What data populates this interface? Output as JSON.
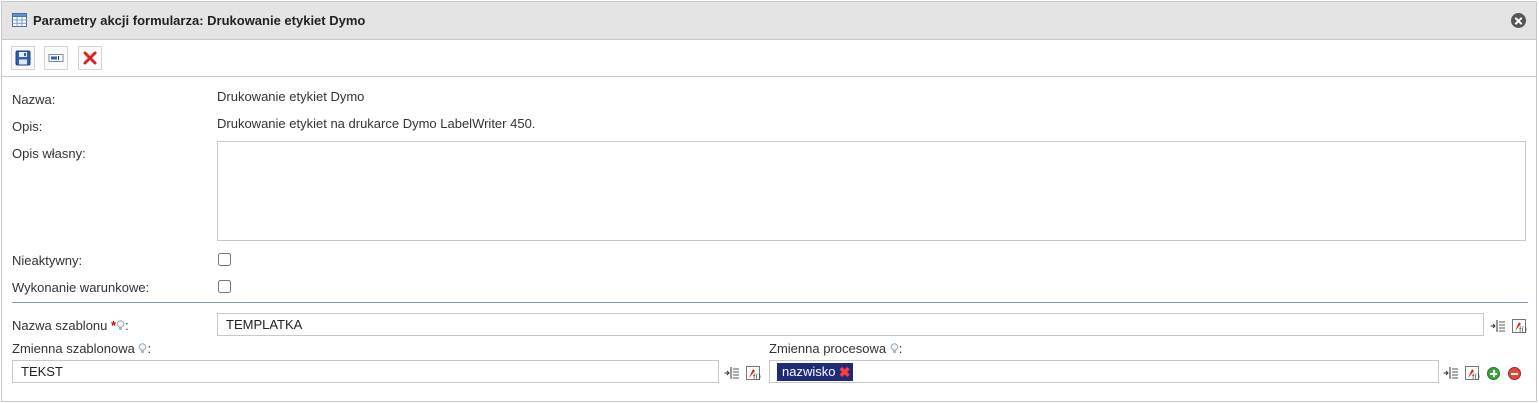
{
  "dialog": {
    "title": "Parametry akcji formularza: Drukowanie etykiet Dymo"
  },
  "toolbar": {
    "buttons": [
      {
        "icon": "save-icon"
      },
      {
        "icon": "textbox-icon"
      },
      {
        "icon": "delete-icon"
      }
    ]
  },
  "form": {
    "name_label": "Nazwa:",
    "name_value": "Drukowanie etykiet Dymo",
    "description_label": "Opis:",
    "description_value": "Drukowanie etykiet na drukarce Dymo LabelWriter 450.",
    "own_description_label": "Opis własny:",
    "own_description_value": "",
    "inactive_label": "Nieaktywny:",
    "inactive_checked": false,
    "conditional_label": "Wykonanie warunkowe:",
    "conditional_checked": false,
    "template_name_label": "Nazwa szablonu",
    "required_mark": "*",
    "colon": ":",
    "template_name_value": "TEMPLATKA",
    "template_variable_label": "Zmienna szablonowa",
    "template_variable_value": "TEKST",
    "process_variable_label": "Zmienna procesowa",
    "process_variable_tags": [
      "nazwisko"
    ],
    "tag_remove_glyph": "✖"
  },
  "colors": {
    "titlebar_bg": "#e4e4e4",
    "tag_bg": "#1f2a78",
    "divider": "#7f9db9",
    "required": "#cc0000"
  }
}
